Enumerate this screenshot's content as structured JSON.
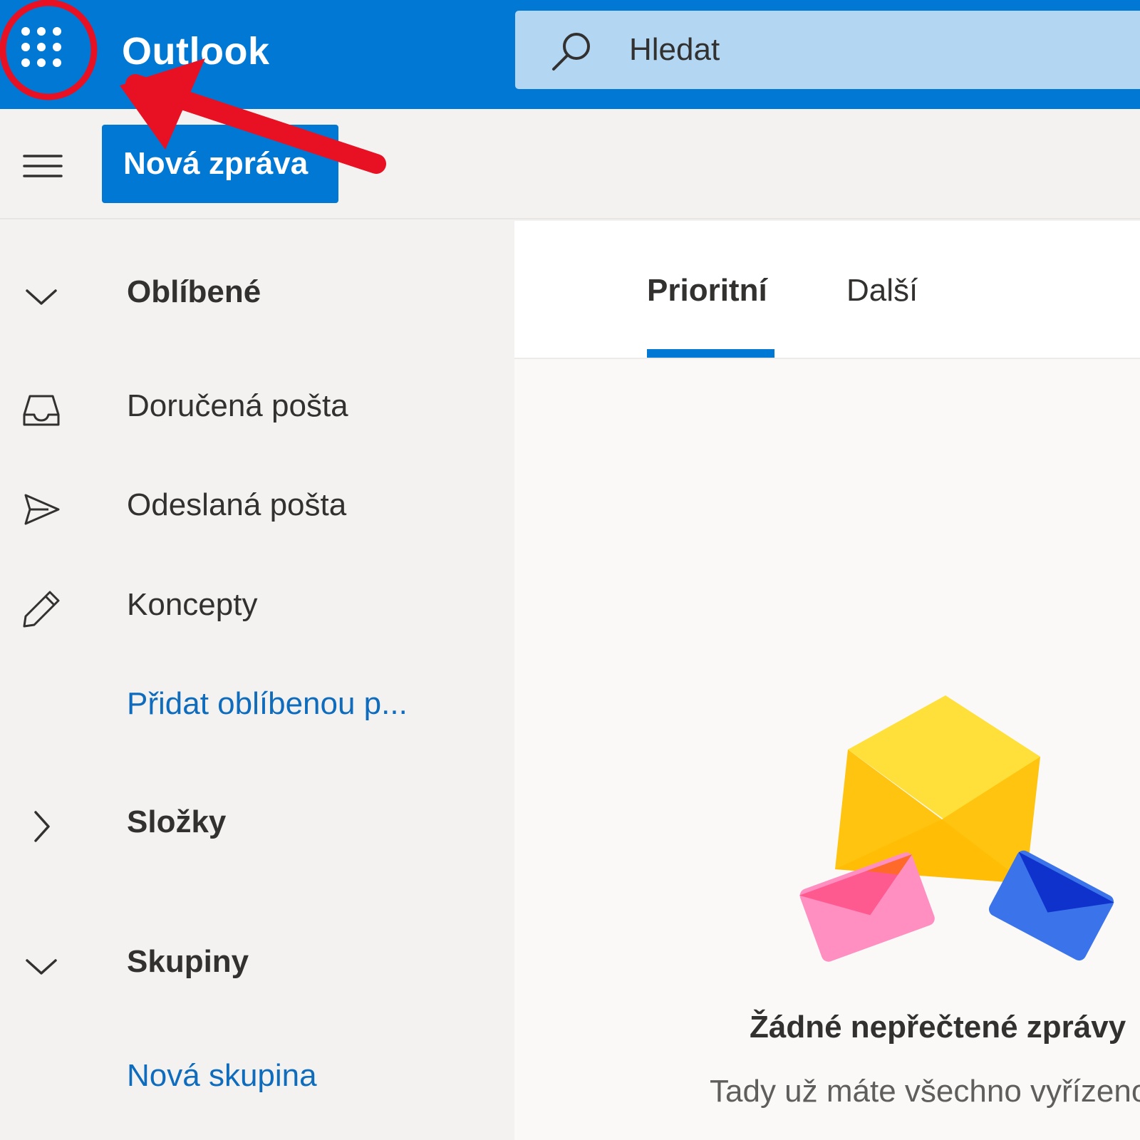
{
  "header": {
    "app_name": "Outlook",
    "search_placeholder": "Hledat"
  },
  "command_bar": {
    "new_message_label": "Nová zpráva"
  },
  "sidebar": {
    "sections": [
      {
        "label": "Oblíbené",
        "expanded": true,
        "icon": "chevron-down-icon"
      },
      {
        "label": "Složky",
        "expanded": false,
        "icon": "chevron-right-icon"
      },
      {
        "label": "Skupiny",
        "expanded": true,
        "icon": "chevron-down-icon"
      }
    ],
    "favorites": [
      {
        "label": "Doručená pošta",
        "icon": "inbox-icon"
      },
      {
        "label": "Odeslaná pošta",
        "icon": "send-icon"
      },
      {
        "label": "Koncepty",
        "icon": "pencil-icon"
      }
    ],
    "add_favorite_label": "Přidat oblíbenou p...",
    "new_group_label": "Nová skupina"
  },
  "main": {
    "tabs": [
      {
        "label": "Prioritní",
        "active": true
      },
      {
        "label": "Další",
        "active": false
      }
    ],
    "empty_state": {
      "title": "Žádné nepřečtené zprávy",
      "subtitle": "Tady už máte všechno vyřízeno"
    }
  },
  "colors": {
    "brand_blue": "#0078d4",
    "search_bg": "#b3d6f2",
    "annotation_red": "#e81123"
  }
}
